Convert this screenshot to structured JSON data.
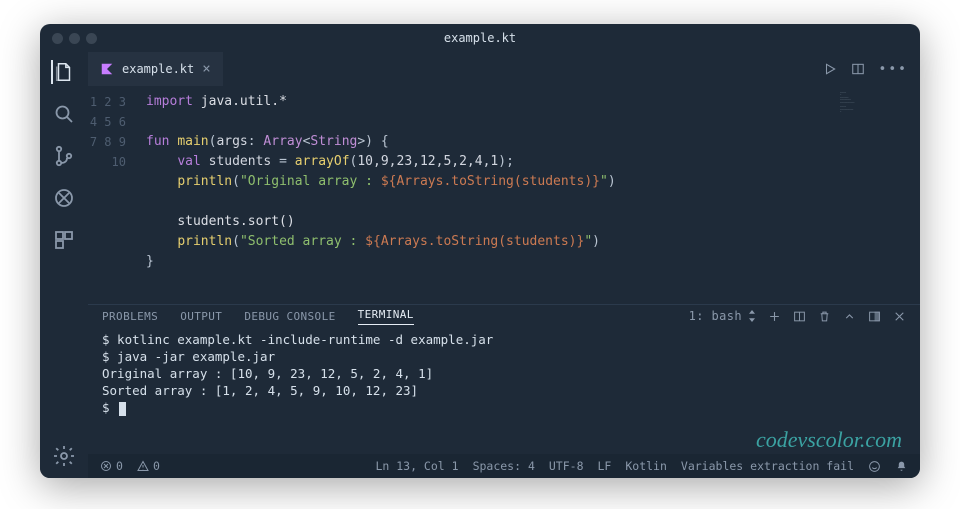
{
  "window": {
    "title": "example.kt"
  },
  "tabs": [
    {
      "label": "example.kt"
    }
  ],
  "gutter": [
    "1",
    "2",
    "3",
    "4",
    "5",
    "6",
    "7",
    "8",
    "9",
    "10"
  ],
  "code": {
    "l1": {
      "import": "import",
      "pkg": "java.util.*"
    },
    "l3": {
      "fun": "fun",
      "name": "main",
      "args": "args",
      "arr": "Array",
      "str": "String"
    },
    "l4": {
      "val": "val",
      "name": "students",
      "fn": "arrayOf",
      "nums": "10,9,23,12,5,2,4,1"
    },
    "l5": {
      "fn": "println",
      "s1": "\"Original array : ",
      "tpl": "${Arrays.toString(students)}",
      "s2": "\""
    },
    "l7": {
      "call": "students.sort()"
    },
    "l8": {
      "fn": "println",
      "s1": "\"Sorted array : ",
      "tpl": "${Arrays.toString(students)}",
      "s2": "\""
    }
  },
  "panel": {
    "tabs": {
      "problems": "PROBLEMS",
      "output": "OUTPUT",
      "debug": "DEBUG CONSOLE",
      "terminal": "TERMINAL"
    },
    "shell": "1: bash",
    "lines": [
      "$ kotlinc example.kt -include-runtime -d example.jar",
      "$ java -jar example.jar",
      "Original array : [10, 9, 23, 12, 5, 2, 4, 1]",
      "Sorted array : [1, 2, 4, 5, 9, 10, 12, 23]",
      "$ "
    ]
  },
  "watermark": "codevscolor.com",
  "status": {
    "errors": "0",
    "warnings": "0",
    "pos": "Ln 13, Col 1",
    "spaces": "Spaces: 4",
    "encoding": "UTF-8",
    "eol": "LF",
    "lang": "Kotlin",
    "msg": "Variables extraction fail"
  }
}
